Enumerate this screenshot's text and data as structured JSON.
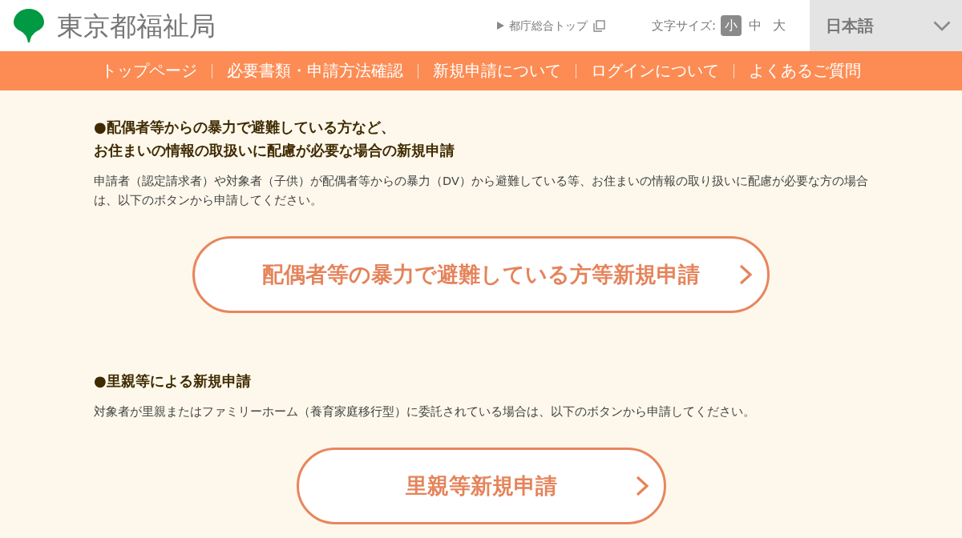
{
  "header": {
    "logo_text": "東京都福祉局",
    "top_link": "都庁総合トップ",
    "text_size": {
      "label": "文字サイズ:",
      "options": [
        {
          "label": "小",
          "selected": true
        },
        {
          "label": "中",
          "selected": false
        },
        {
          "label": "大",
          "selected": false
        }
      ]
    },
    "language": "日本語"
  },
  "nav": [
    {
      "label": "トップページ"
    },
    {
      "label": "必要書類・申請方法確認"
    },
    {
      "label": "新規申請について"
    },
    {
      "label": "ログインについて"
    },
    {
      "label": "よくあるご質問"
    }
  ],
  "sections": [
    {
      "title_lines": [
        "●配偶者等からの暴力で避難している方など、",
        "お住まいの情報の取扱いに配慮が必要な場合の新規申請"
      ],
      "description": "申請者（認定請求者）や対象者（子供）が配偶者等からの暴力（DV）から避難している等、お住まいの情報の取り扱いに配慮が必要な方の場合は、以下のボタンから申請してください。",
      "button": "配偶者等の暴力で避難している方等新規申請"
    },
    {
      "title_lines": [
        "●里親等による新規申請"
      ],
      "description": "対象者が里親またはファミリーホーム（養育家庭移行型）に委託されている場合は、以下のボタンから申請してください。",
      "button": "里親等新規申請"
    }
  ]
}
